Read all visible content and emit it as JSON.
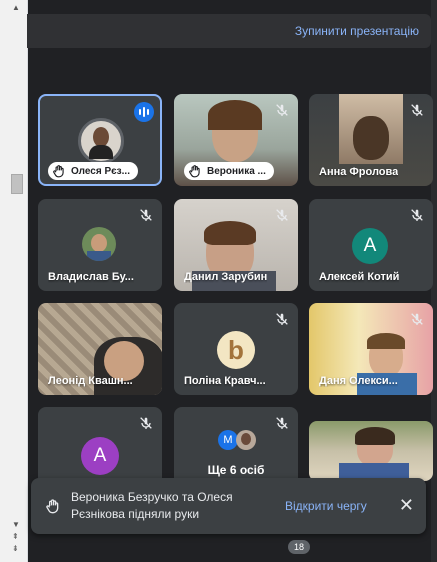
{
  "banner": {
    "stop_label": "Зупинити презентацію"
  },
  "tiles": [
    {
      "name": "Олеся Рєз...",
      "raised_hand": true,
      "speaking": true
    },
    {
      "name": "Вероника ...",
      "raised_hand": true
    },
    {
      "name": "Анна Фролова"
    },
    {
      "name": "Владислав Бу..."
    },
    {
      "name": "Данил Зарубин"
    },
    {
      "name": "Алексей Котий",
      "initial": "А"
    },
    {
      "name": "Леонід Квашн..."
    },
    {
      "name": "Поліна Кравч..."
    },
    {
      "name": "Даня Олекси..."
    },
    {
      "initial": "А"
    }
  ],
  "more": {
    "label": "Ще 6 осіб",
    "avatar_initial": "M"
  },
  "toast": {
    "text": "Вероника Безручко та Олеся Рєзнікова підняли руки",
    "open_queue": "Відкрити чергу",
    "close": "✕"
  },
  "participant_count": "18",
  "colors": {
    "accent": "#8ab4f8",
    "teal": "#12887a",
    "purple": "#9c3fc3",
    "blue": "#1a73e8"
  },
  "icons": [
    "mic-off-icon",
    "hand-raised-icon",
    "speaking-icon",
    "close-icon"
  ]
}
